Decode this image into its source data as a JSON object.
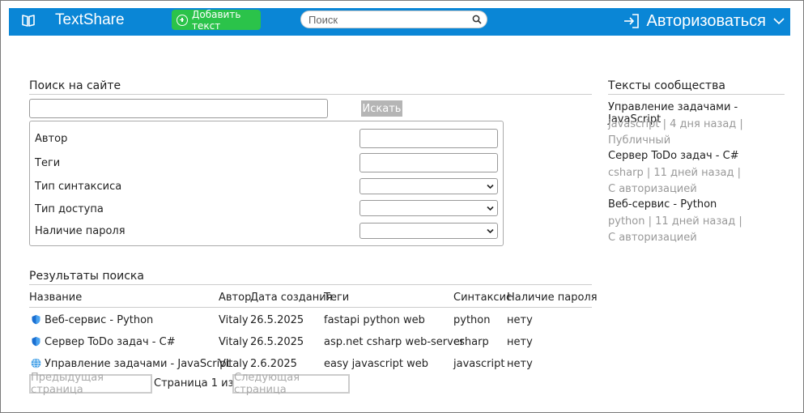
{
  "header": {
    "brand": "TextShare",
    "add_button": "Добавить текст",
    "search_placeholder": "Поиск",
    "login": "Авторизоваться",
    "colors": {
      "bar": "#0a86d6",
      "add_button": "#2bc34a"
    }
  },
  "site_search": {
    "title": "Поиск на сайте",
    "query_value": "",
    "search_button": "Искать",
    "filters": [
      {
        "label": "Автор",
        "kind": "text",
        "value": ""
      },
      {
        "label": "Теги",
        "kind": "text",
        "value": ""
      },
      {
        "label": "Тип синтаксиса",
        "kind": "select",
        "value": ""
      },
      {
        "label": "Тип доступа",
        "kind": "select",
        "value": ""
      },
      {
        "label": "Наличие пароля",
        "kind": "select",
        "value": ""
      }
    ]
  },
  "results": {
    "title": "Результаты поиска",
    "columns": [
      "Название",
      "Автор",
      "Дата создания",
      "Теги",
      "Синтаксис",
      "Наличие пароля"
    ],
    "rows": [
      {
        "icon": "shield-icon",
        "name": "Веб-сервис - Python",
        "author": "Vitaly",
        "date": "26.5.2025",
        "tags": "fastapi python web",
        "syntax": "python",
        "password": "нету"
      },
      {
        "icon": "shield-icon",
        "name": "Сервер ToDo задач - C#",
        "author": "Vitaly",
        "date": "26.5.2025",
        "tags": "asp.net csharp web-server",
        "syntax": "csharp",
        "password": "нету"
      },
      {
        "icon": "globe-icon",
        "name": "Управление задачами - JavaScript",
        "author": "Vitaly",
        "date": "2.6.2025",
        "tags": "easy javascript web",
        "syntax": "javascript",
        "password": "нету"
      }
    ],
    "prev_button": "Предыдущая страница",
    "page_info": "Страница 1 из 1",
    "next_button": "Следующая страница"
  },
  "community": {
    "title": "Тексты сообщества",
    "items": [
      {
        "title": "Управление задачами - JavaScript",
        "meta": "javascript | 4 дня назад | Публичный"
      },
      {
        "title": "Сервер ToDo задач - C#",
        "meta": "csharp | 11 дней назад | С авторизацией"
      },
      {
        "title": "Веб-сервис - Python",
        "meta": "python | 11 дней назад | С авторизацией"
      }
    ]
  }
}
